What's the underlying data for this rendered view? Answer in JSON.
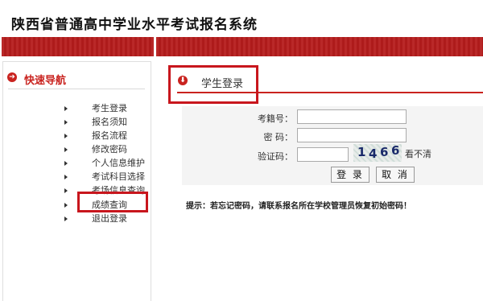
{
  "site": {
    "title": "陕西省普通高中学业水平考试报名系统"
  },
  "colors": {
    "brand_red": "#c9231f",
    "banner_red": "#b51c1c",
    "highlight_red": "#c8161d",
    "form_bg": "#f4f4f4"
  },
  "nav": {
    "title": "快速导航",
    "icon": "arrow-circle-icon",
    "items": [
      {
        "label": "考生登录"
      },
      {
        "label": "报名须知"
      },
      {
        "label": "报名流程"
      },
      {
        "label": "修改密码"
      },
      {
        "label": "个人信息维护"
      },
      {
        "label": "考试科目选择"
      },
      {
        "label": "考场信息查询"
      },
      {
        "label": "成绩查询"
      },
      {
        "label": "退出登录"
      }
    ],
    "highlighted_item": "成绩查询"
  },
  "login": {
    "title": "学生登录",
    "icon": "down-arrow-circle-icon",
    "fields": {
      "exam_number_label": "考籍号：",
      "exam_number_value": "",
      "password_label": "密 码：",
      "password_value": "",
      "captcha_label": "验证码：",
      "captcha_value": ""
    },
    "captcha_text": [
      "1",
      "4",
      "6",
      "6"
    ],
    "refresh_label": "看不清",
    "login_button": "登 录",
    "cancel_button": "取 消"
  },
  "tip": "提示：若忘记密码，请联系报名所在学校管理员恢复初始密码！"
}
